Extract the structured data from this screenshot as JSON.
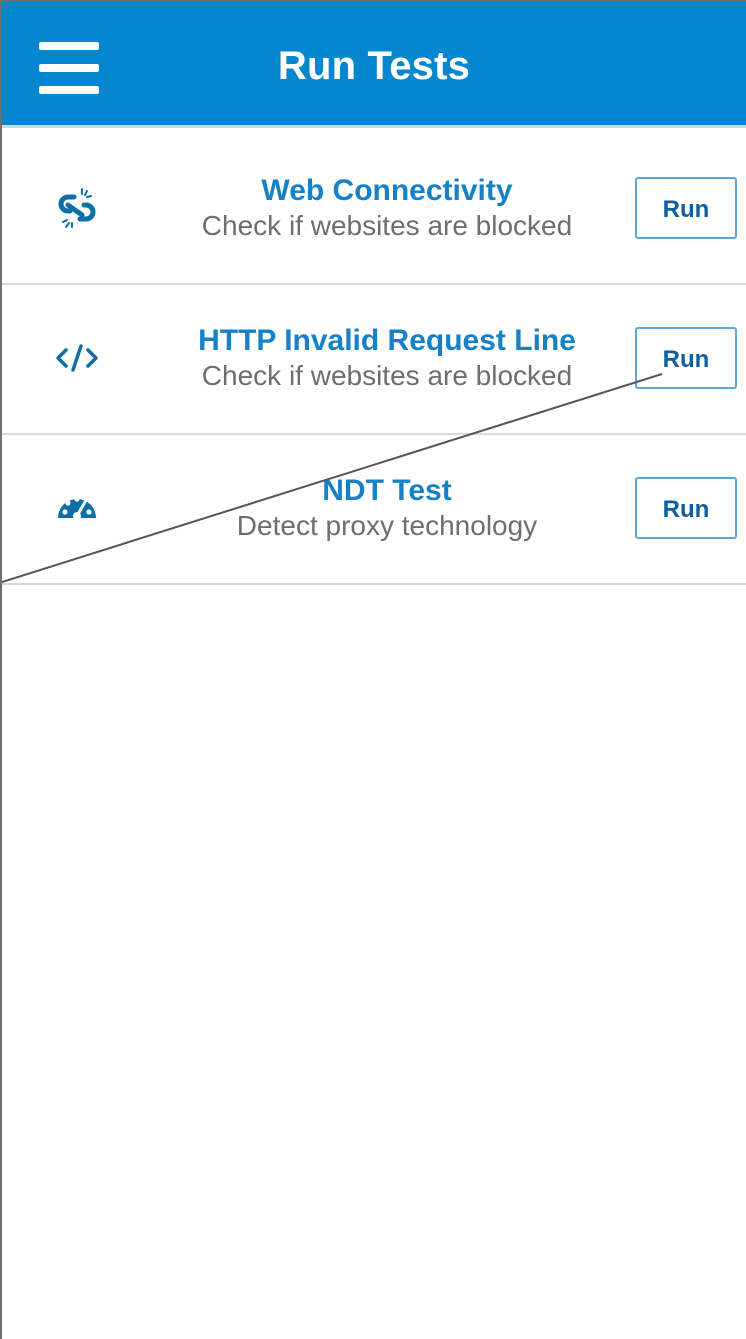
{
  "header": {
    "title": "Run Tests",
    "menu_icon": "hamburger-menu-icon",
    "background_color": "#0587cf"
  },
  "tests": [
    {
      "icon": "broken-link-icon",
      "title": "Web Connectivity",
      "subtitle": "Check if websites are blocked",
      "button": "Run"
    },
    {
      "icon": "code-brackets-icon",
      "title": "HTTP Invalid Request Line",
      "subtitle": "Check if websites are blocked",
      "button": "Run"
    },
    {
      "icon": "speedometer-icon",
      "title": "NDT Test",
      "subtitle": "Detect proxy technology",
      "button": "Run"
    }
  ],
  "colors": {
    "accent": "#1581c6",
    "button_border": "#5aa8dc",
    "subtitle": "#6e6e6e"
  }
}
